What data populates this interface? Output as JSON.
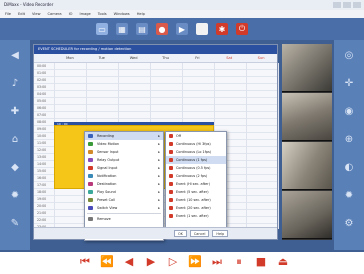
{
  "window": {
    "title": "DiMaxx - Video Recorder"
  },
  "menu": [
    "File",
    "Edit",
    "View",
    "Camera",
    "IO",
    "Image",
    "Tools",
    "Windows",
    "Help"
  ],
  "panel": {
    "title": "EVENT SCHEDULER for recording / motion detection"
  },
  "days": [
    "Mon",
    "Tue",
    "Wed",
    "Thu",
    "Fri",
    "Sat",
    "Sun"
  ],
  "times": [
    "00:00",
    "01:00",
    "02:00",
    "03:00",
    "04:00",
    "05:00",
    "06:00",
    "07:00",
    "08:00",
    "09:00",
    "10:00",
    "11:00",
    "12:00",
    "13:00",
    "14:00",
    "15:00",
    "16:00",
    "17:00",
    "18:00",
    "19:00",
    "20:00",
    "21:00",
    "22:00",
    "23:00"
  ],
  "event": {
    "bar_label": "10 : 00"
  },
  "context_menu": [
    {
      "label": "Recording",
      "icon_color": "#3a62b8",
      "submenu": true,
      "selected": true
    },
    {
      "label": "Video Motion",
      "icon_color": "#3a9a3a",
      "submenu": true
    },
    {
      "label": "Sensor Input",
      "icon_color": "#d2892a",
      "submenu": true
    },
    {
      "label": "Relay Output",
      "icon_color": "#8a4ab8",
      "submenu": true
    },
    {
      "label": "Signal Input",
      "icon_color": "#d23a2a",
      "submenu": true
    },
    {
      "label": "Notification",
      "icon_color": "#3a8ab8",
      "submenu": true
    },
    {
      "label": "Destination",
      "icon_color": "#b83a7a",
      "submenu": true
    },
    {
      "label": "Play Sound",
      "icon_color": "#3aa89a",
      "submenu": true
    },
    {
      "label": "Preset Call",
      "icon_color": "#7a8a3a",
      "submenu": true
    },
    {
      "label": "Switch View",
      "icon_color": "#4a4ab8",
      "submenu": true
    },
    {
      "label": "Remove",
      "icon_color": "#777777",
      "submenu": false
    }
  ],
  "submenu": [
    {
      "label": "Off",
      "selected": false
    },
    {
      "label": "Continuous (Hi 3fps)",
      "selected": false
    },
    {
      "label": "Continuous (Lo 1fps)",
      "selected": false
    },
    {
      "label": "Continuous (1 fps)",
      "selected": true
    },
    {
      "label": "Continuous (0.5 fps)",
      "selected": false
    },
    {
      "label": "Continuous (2 fps)",
      "selected": false
    },
    {
      "label": "Event (Hi sec. after)",
      "selected": false
    },
    {
      "label": "Event (5 sec. after)",
      "selected": false
    },
    {
      "label": "Event (10 sec. after)",
      "selected": false
    },
    {
      "label": "Event (20 sec. after)",
      "selected": false
    },
    {
      "label": "Event (1 sec. after)",
      "selected": false
    }
  ],
  "footer": {
    "ok": "OK",
    "cancel": "Cancel",
    "help": "Help"
  },
  "colors": {
    "toolbar": "#4a6fa8",
    "panel_title": "#2b50a0",
    "event": "#f5c518",
    "accent_red": "#d23a2a"
  },
  "toolbar_icons": [
    "monitor-icon",
    "layout-icon",
    "grid-icon",
    "record-icon",
    "playback-icon",
    "alarm-icon",
    "settings-icon",
    "exit-icon"
  ],
  "side_icons_left": [
    "speaker-icon",
    "microphone-icon",
    "tools-icon",
    "lock-icon",
    "alarm-icon",
    "gear-icon",
    "wrench-icon"
  ],
  "side_icons_right": [
    "globe-icon",
    "joystick-icon",
    "focus-icon",
    "zoom-icon",
    "iris-icon",
    "preset-icon",
    "settings-icon"
  ],
  "bottom_icons": [
    "first-icon",
    "rewind-icon",
    "prev-icon",
    "play-icon",
    "next-icon",
    "forward-icon",
    "last-icon",
    "pause-icon",
    "stop-icon",
    "eject-icon"
  ]
}
